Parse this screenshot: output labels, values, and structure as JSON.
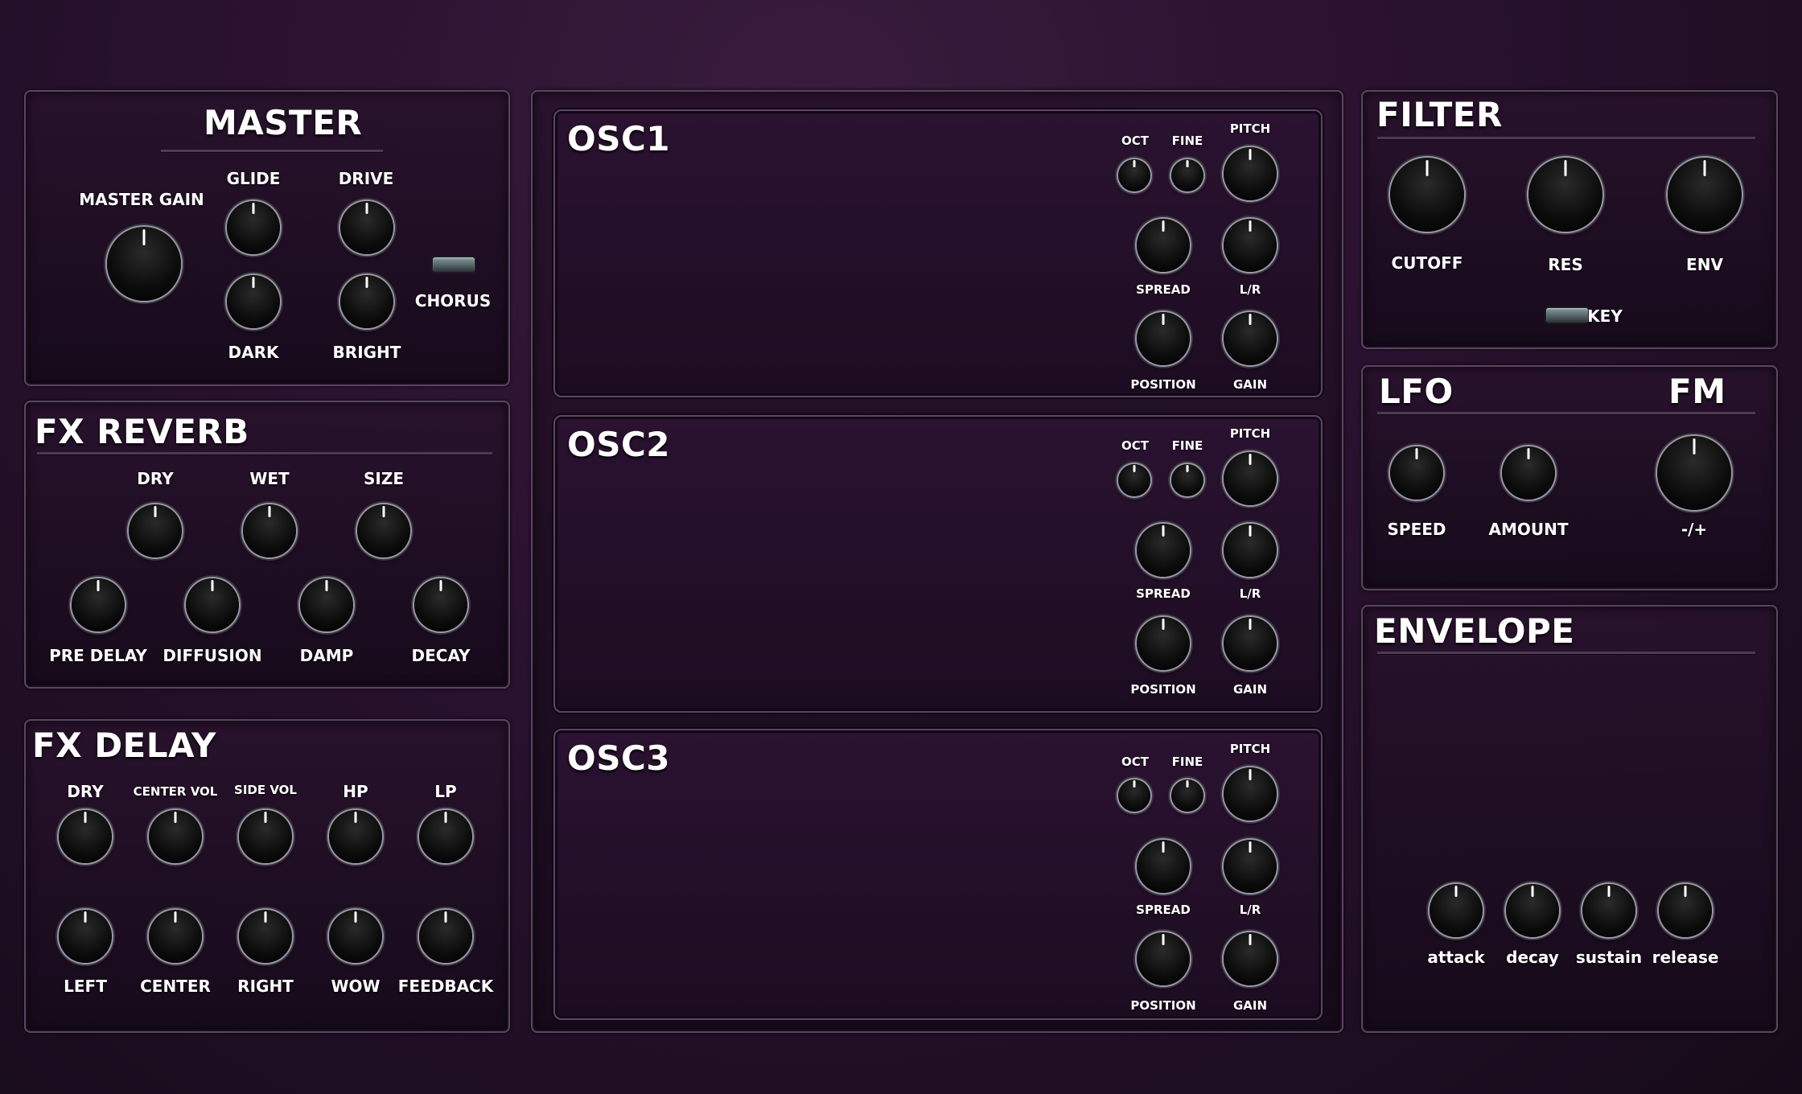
{
  "master": {
    "title": "MASTER",
    "knobs": {
      "master_gain": "MASTER GAIN",
      "glide": "GLIDE",
      "drive": "DRIVE",
      "dark": "DARK",
      "bright": "BRIGHT"
    },
    "chorus": "CHORUS"
  },
  "reverb": {
    "title": "FX REVERB",
    "knobs": {
      "dry": "DRY",
      "wet": "WET",
      "size": "SIZE",
      "pre_delay": "PRE DELAY",
      "diffusion": "DIFFUSION",
      "damp": "DAMP",
      "decay": "DECAY"
    }
  },
  "delay": {
    "title": "FX DELAY",
    "knobs": {
      "dry": "DRY",
      "center_vol": "CENTER VOL",
      "side_vol": "SIDE VOL",
      "hp": "HP",
      "lp": "LP",
      "left": "LEFT",
      "center": "CENTER",
      "right": "RIGHT",
      "wow": "WOW",
      "feedback": "FEEDBACK"
    }
  },
  "osc": {
    "titles": [
      "OSC1",
      "OSC2",
      "OSC3"
    ],
    "labels": {
      "oct": "OCT",
      "fine": "FINE",
      "pitch": "PITCH",
      "spread": "SPREAD",
      "lr": "L/R",
      "position": "POSITION",
      "gain": "GAIN"
    }
  },
  "filter": {
    "title": "FILTER",
    "knobs": {
      "cutoff": "CUTOFF",
      "res": "RES",
      "env": "ENV"
    },
    "key": "KEY"
  },
  "lfo": {
    "title": "LFO",
    "fm_title": "FM",
    "knobs": {
      "speed": "SPEED",
      "amount": "AMOUNT",
      "fm": "-/+"
    }
  },
  "envelope": {
    "title": "ENVELOPE",
    "knobs": {
      "attack": "attack",
      "decay": "decay",
      "sustain": "sustain",
      "release": "release"
    }
  },
  "colors": {
    "background": "#2a1230",
    "panel_border": "#5a4560",
    "knob": "#0b0b0b",
    "knob_ring": "#9a98a4"
  }
}
